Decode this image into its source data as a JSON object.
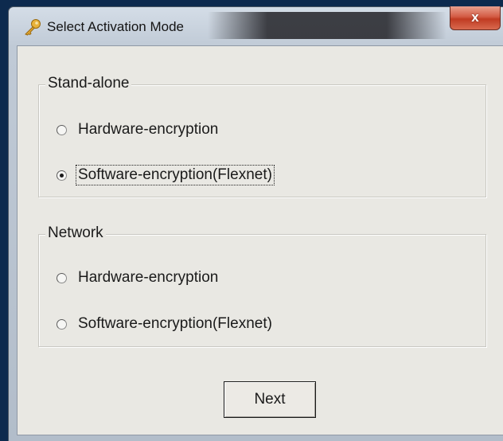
{
  "window": {
    "title": "Select Activation Mode",
    "close_label": "x"
  },
  "groups": [
    {
      "legend": "Stand-alone",
      "options": [
        {
          "label": "Hardware-encryption",
          "checked": false
        },
        {
          "label": "Software-encryption(Flexnet)",
          "checked": true
        }
      ]
    },
    {
      "legend": "Network",
      "options": [
        {
          "label": "Hardware-encryption",
          "checked": false
        },
        {
          "label": "Software-encryption(Flexnet)",
          "checked": false
        }
      ]
    }
  ],
  "buttons": {
    "next_label": "Next"
  },
  "icons": {
    "title_icon": "key-icon"
  },
  "colors": {
    "desktop": "#0d2a4e",
    "close_button": "#c03b22",
    "dialog_face": "#e9e8e3"
  }
}
